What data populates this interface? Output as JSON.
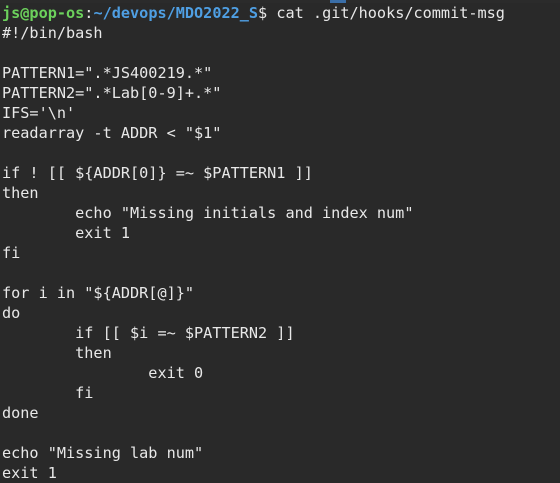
{
  "prompt": {
    "user_host": "js@pop-os",
    "separator": ":",
    "path": "~/devops/MDO2022_S",
    "symbol": "$",
    "command": " cat .git/hooks/commit-msg"
  },
  "output_lines": [
    "#!/bin/bash",
    "",
    "PATTERN1=\".*JS400219.*\"",
    "PATTERN2=\".*Lab[0-9]+.*\"",
    "IFS='\\n'",
    "readarray -t ADDR < \"$1\"",
    "",
    "if ! [[ ${ADDR[0]} =~ $PATTERN1 ]]",
    "then",
    "        echo \"Missing initials and index num\"",
    "        exit 1",
    "fi",
    "",
    "for i in \"${ADDR[@]}\"",
    "do",
    "        if [[ $i =~ $PATTERN2 ]]",
    "        then",
    "                exit 0",
    "        fi",
    "done",
    "",
    "echo \"Missing lab num\"",
    "exit 1"
  ],
  "colors": {
    "background": "#292929",
    "text": "#e8e8e8",
    "user_host": "#6cd15c",
    "path": "#4f9fe3"
  }
}
